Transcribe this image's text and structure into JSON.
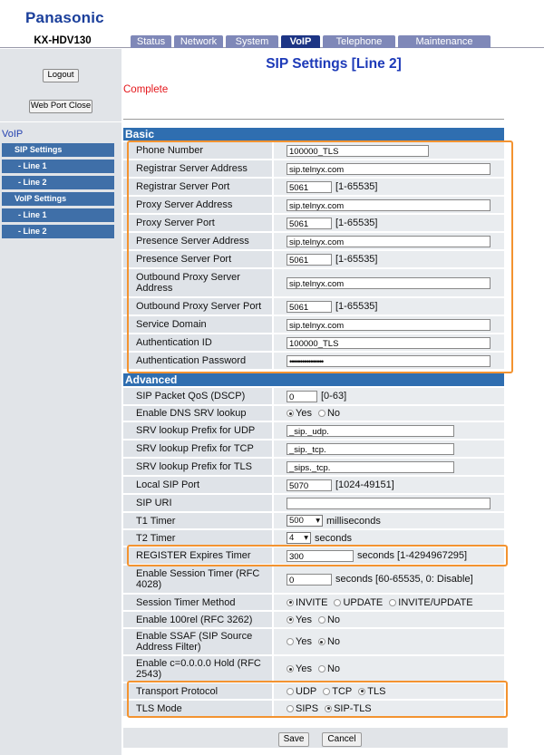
{
  "brand": "Panasonic",
  "model": "KX-HDV130",
  "tabs": [
    "Status",
    "Network",
    "System",
    "VoIP",
    "Telephone",
    "Maintenance"
  ],
  "active_tab": "VoIP",
  "sidebar": {
    "logout": "Logout",
    "web_port_close": "Web Port Close",
    "section": "VoIP",
    "items": [
      "SIP Settings",
      "- Line 1",
      "- Line 2",
      "VoIP Settings",
      "- Line 1",
      "- Line 2"
    ]
  },
  "page_title": "SIP Settings [Line 2]",
  "status_message": "Complete",
  "basic": {
    "title": "Basic",
    "rows": [
      {
        "label": "Phone Number",
        "value": "100000_TLS"
      },
      {
        "label": "Registrar Server Address",
        "value": "sip.telnyx.com"
      },
      {
        "label": "Registrar Server Port",
        "value": "5061",
        "hint": "[1-65535]"
      },
      {
        "label": "Proxy Server Address",
        "value": "sip.telnyx.com"
      },
      {
        "label": "Proxy Server Port",
        "value": "5061",
        "hint": "[1-65535]"
      },
      {
        "label": "Presence Server Address",
        "value": "sip.telnyx.com"
      },
      {
        "label": "Presence Server Port",
        "value": "5061",
        "hint": "[1-65535]"
      },
      {
        "label": "Outbound Proxy Server Address",
        "value": "sip.telnyx.com"
      },
      {
        "label": "Outbound Proxy Server Port",
        "value": "5061",
        "hint": "[1-65535]"
      },
      {
        "label": "Service Domain",
        "value": "sip.telnyx.com"
      },
      {
        "label": "Authentication ID",
        "value": "100000_TLS"
      },
      {
        "label": "Authentication Password",
        "value": "••••••••••••••••"
      }
    ]
  },
  "advanced": {
    "title": "Advanced",
    "qos": {
      "label": "SIP Packet QoS (DSCP)",
      "value": "0",
      "hint": "[0-63]"
    },
    "dns_srv": {
      "label": "Enable DNS SRV lookup",
      "yes": "Yes",
      "no": "No",
      "selected": "Yes"
    },
    "srv_udp": {
      "label": "SRV lookup Prefix for UDP",
      "value": "_sip._udp."
    },
    "srv_tcp": {
      "label": "SRV lookup Prefix for TCP",
      "value": "_sip._tcp."
    },
    "srv_tls": {
      "label": "SRV lookup Prefix for TLS",
      "value": "_sips._tcp."
    },
    "local_port": {
      "label": "Local SIP Port",
      "value": "5070",
      "hint": "[1024-49151]"
    },
    "sip_uri": {
      "label": "SIP URI",
      "value": ""
    },
    "t1": {
      "label": "T1 Timer",
      "value": "500",
      "unit": "milliseconds"
    },
    "t2": {
      "label": "T2 Timer",
      "value": "4",
      "unit": "seconds"
    },
    "register_expires": {
      "label": "REGISTER Expires Timer",
      "value": "300",
      "unit": "seconds [1-4294967295]"
    },
    "session_timer": {
      "label": "Enable Session Timer (RFC 4028)",
      "value": "0",
      "unit": "seconds [60-65535, 0: Disable]"
    },
    "session_method": {
      "label": "Session Timer Method",
      "options": [
        "INVITE",
        "UPDATE",
        "INVITE/UPDATE"
      ],
      "selected": "INVITE"
    },
    "rel100": {
      "label": "Enable 100rel (RFC 3262)",
      "yes": "Yes",
      "no": "No",
      "selected": "Yes"
    },
    "ssaf": {
      "label": "Enable SSAF (SIP Source Address Filter)",
      "yes": "Yes",
      "no": "No",
      "selected": "No"
    },
    "c0hold": {
      "label": "Enable c=0.0.0.0 Hold (RFC 2543)",
      "yes": "Yes",
      "no": "No",
      "selected": "Yes"
    },
    "transport": {
      "label": "Transport Protocol",
      "options": [
        "UDP",
        "TCP",
        "TLS"
      ],
      "selected": "TLS"
    },
    "tls_mode": {
      "label": "TLS Mode",
      "options": [
        "SIPS",
        "SIP-TLS"
      ],
      "selected": "SIP-TLS"
    }
  },
  "buttons": {
    "save": "Save",
    "cancel": "Cancel"
  },
  "colors": {
    "brand": "#1b3f9b",
    "tab_active": "#1d3585",
    "section_header": "#2f6eb0",
    "highlight": "#f39330",
    "status": "#e4161b"
  }
}
